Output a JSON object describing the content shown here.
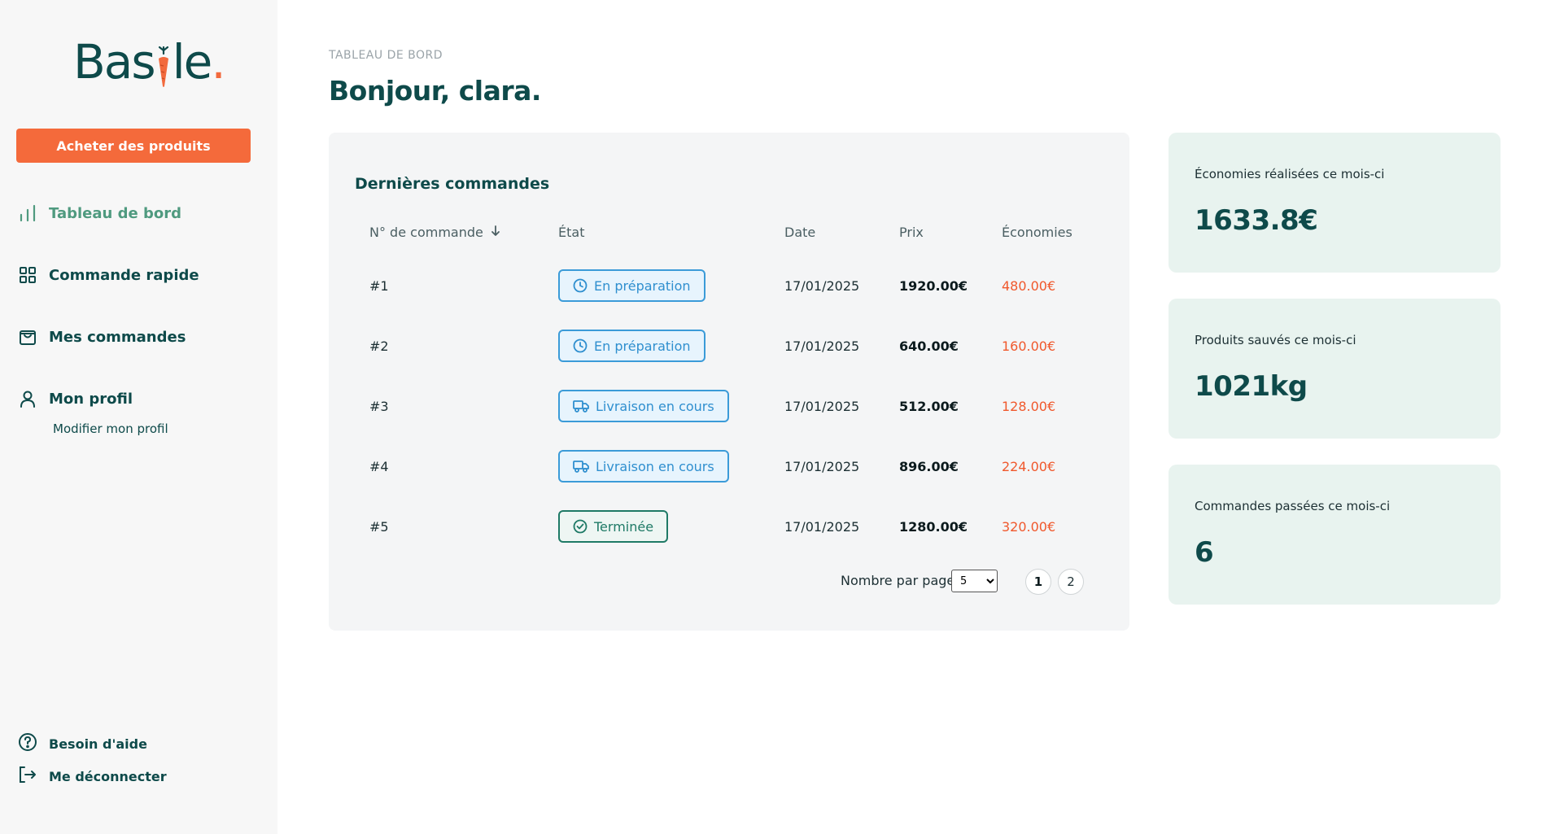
{
  "brand": {
    "logo_text_left": "Bas",
    "logo_text_right": "le",
    "logo_dot": "."
  },
  "colors": {
    "accent": "#f46a3b",
    "primary": "#0e4a4a",
    "active": "#4f9a7f",
    "savings": "#f0582c",
    "stat_bg": "#e8f3ef"
  },
  "sidebar": {
    "cta_label": "Acheter des produits",
    "nav": [
      {
        "label": "Tableau de bord",
        "icon": "bar-chart-icon",
        "active": true
      },
      {
        "label": "Commande rapide",
        "icon": "grid-icon",
        "active": false
      },
      {
        "label": "Mes commandes",
        "icon": "shopping-bag-icon",
        "active": false
      },
      {
        "label": "Mon profil",
        "icon": "user-icon",
        "active": false
      }
    ],
    "profile_sub": "Modifier mon profil",
    "footer": [
      {
        "label": "Besoin d'aide",
        "icon": "help-circle-icon"
      },
      {
        "label": "Me déconnecter",
        "icon": "logout-icon"
      }
    ]
  },
  "header": {
    "breadcrumb": "TABLEAU DE BORD",
    "greeting": "Bonjour, clara."
  },
  "orders": {
    "title": "Dernières commandes",
    "columns": {
      "number": "N° de commande",
      "status": "État",
      "date": "Date",
      "price": "Prix",
      "savings": "Économies"
    },
    "rows": [
      {
        "number": "#1",
        "status": "En préparation",
        "status_type": "prep",
        "status_icon": "clock-icon",
        "date": "17/01/2025",
        "price": "1920.00€",
        "savings": "480.00€"
      },
      {
        "number": "#2",
        "status": "En préparation",
        "status_type": "prep",
        "status_icon": "clock-icon",
        "date": "17/01/2025",
        "price": "640.00€",
        "savings": "160.00€"
      },
      {
        "number": "#3",
        "status": "Livraison en cours",
        "status_type": "deliv",
        "status_icon": "truck-icon",
        "date": "17/01/2025",
        "price": "512.00€",
        "savings": "128.00€"
      },
      {
        "number": "#4",
        "status": "Livraison en cours",
        "status_type": "deliv",
        "status_icon": "truck-icon",
        "date": "17/01/2025",
        "price": "896.00€",
        "savings": "224.00€"
      },
      {
        "number": "#5",
        "status": "Terminée",
        "status_type": "done",
        "status_icon": "check-circle-icon",
        "date": "17/01/2025",
        "price": "1280.00€",
        "savings": "320.00€"
      }
    ],
    "pagination": {
      "per_page_label": "Nombre par page",
      "per_page_value": "5",
      "pages": [
        "1",
        "2"
      ],
      "current_page": "1"
    }
  },
  "stats": [
    {
      "label": "Économies réalisées ce mois-ci",
      "value": "1633.8€"
    },
    {
      "label": "Produits sauvés ce mois-ci",
      "value": "1021kg"
    },
    {
      "label": "Commandes passées ce mois-ci",
      "value": "6"
    }
  ]
}
